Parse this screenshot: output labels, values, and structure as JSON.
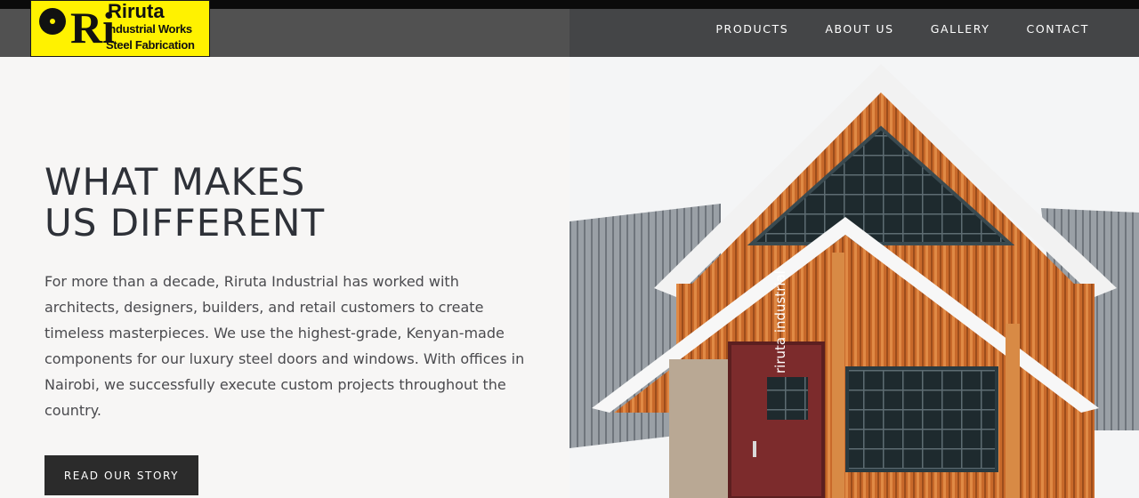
{
  "header": {
    "logo": {
      "monogram": "Ri",
      "line1": "Riruta",
      "line2": "Industrial Works",
      "line3": "Steel Fabrication",
      "bg_color": "#fff200"
    },
    "nav": [
      {
        "label": "PRODUCTS"
      },
      {
        "label": "ABOUT US"
      },
      {
        "label": "GALLERY"
      },
      {
        "label": "CONTACT"
      }
    ]
  },
  "hero": {
    "title_line1": "WHAT MAKES",
    "title_line2": "US DIFFERENT",
    "body": "For more than a decade, Riruta Industrial has worked with architects, designers, builders, and retail customers to create timeless masterpieces. We use the highest-grade, Kenyan-made components for our luxury steel doors and windows. With offices in Nairobi, we successfully execute custom projects throughout the country.",
    "button_label": "READ OUR STORY"
  },
  "photo": {
    "watermark": "riruta industrial",
    "colors": {
      "wood": "#c56a2b",
      "roof": "#8d9196",
      "door": "#7a2b2b",
      "trim": "#ffffff"
    }
  }
}
